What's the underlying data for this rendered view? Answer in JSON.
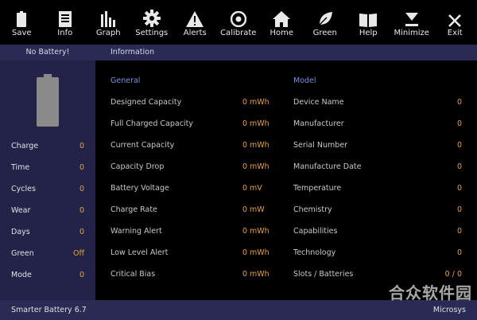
{
  "toolbar": [
    {
      "label": "Save",
      "icon": "battery-icon"
    },
    {
      "label": "Info",
      "icon": "document-icon"
    },
    {
      "label": "Graph",
      "icon": "bar-chart-icon"
    },
    {
      "label": "Settings",
      "icon": "gear-icon"
    },
    {
      "label": "Alerts",
      "icon": "warning-icon"
    },
    {
      "label": "Calibrate",
      "icon": "target-icon"
    },
    {
      "label": "Home",
      "icon": "home-icon"
    },
    {
      "label": "Green",
      "icon": "leaf-icon"
    },
    {
      "label": "Help",
      "icon": "book-icon"
    },
    {
      "label": "Minimize",
      "icon": "minimize-icon"
    },
    {
      "label": "Exit",
      "icon": "close-icon"
    }
  ],
  "strip": {
    "status": "No Battery!",
    "section": "Information"
  },
  "left": {
    "rows": [
      {
        "label": "Charge",
        "value": "0"
      },
      {
        "label": "Time",
        "value": "0"
      },
      {
        "label": "Cycles",
        "value": "0"
      },
      {
        "label": "Wear",
        "value": "0"
      },
      {
        "label": "Days",
        "value": "0"
      },
      {
        "label": "Green",
        "value": "Off"
      },
      {
        "label": "Mode",
        "value": "0"
      }
    ]
  },
  "general": {
    "title": "General",
    "rows": [
      {
        "label": "Designed Capacity",
        "value": "0",
        "unit": "mWh"
      },
      {
        "label": "Full Charged Capacity",
        "value": "0",
        "unit": "mWh"
      },
      {
        "label": "Current Capacity",
        "value": "0",
        "unit": "mWh"
      },
      {
        "label": "Capacity Drop",
        "value": "0",
        "unit": "mWh"
      },
      {
        "label": "Battery Voltage",
        "value": "0",
        "unit": "mV"
      },
      {
        "label": "Charge Rate",
        "value": "0",
        "unit": "mW"
      },
      {
        "label": "Warning Alert",
        "value": "0",
        "unit": "mWh"
      },
      {
        "label": "Low Level Alert",
        "value": "0",
        "unit": "mWh"
      },
      {
        "label": "Critical Bias",
        "value": "0",
        "unit": "mWh"
      }
    ]
  },
  "model": {
    "title": "Model",
    "rows": [
      {
        "label": "Device Name",
        "value": "0"
      },
      {
        "label": "Manufacturer",
        "value": "0"
      },
      {
        "label": "Serial Number",
        "value": "0"
      },
      {
        "label": "Manufacture Date",
        "value": "0"
      },
      {
        "label": "Temperature",
        "value": "0"
      },
      {
        "label": "Chemistry",
        "value": "0"
      },
      {
        "label": "Capabilities",
        "value": "0"
      },
      {
        "label": "Technology",
        "value": "0"
      },
      {
        "label": "Slots / Batteries",
        "value": "0 / 0"
      }
    ]
  },
  "footer": {
    "app": "Smarter Battery 6.7",
    "vendor": "Microsys"
  },
  "watermark": "合众软件园"
}
